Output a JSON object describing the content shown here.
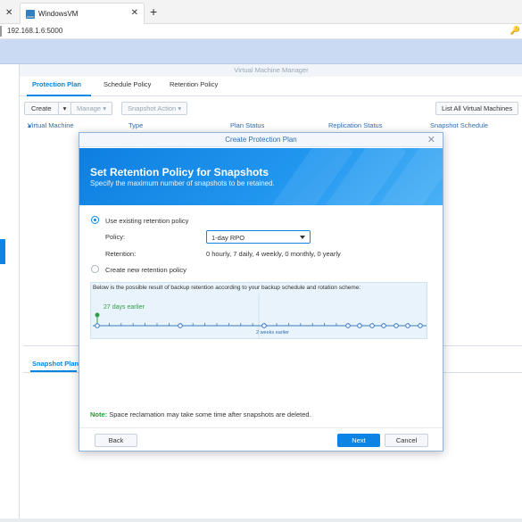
{
  "browser": {
    "tab_title": "WindowsVM",
    "url": "192.168.1.6:5000"
  },
  "app": {
    "title": "Virtual Machine Manager",
    "tabs": [
      "Protection Plan",
      "Schedule Policy",
      "Retention Policy"
    ],
    "toolbar": {
      "create": "Create",
      "manage": "Manage",
      "snapshot_action": "Snapshot Action",
      "list_all": "List All Virtual Machines"
    },
    "columns": [
      "Virtual Machine",
      "Type",
      "Plan Status",
      "Replication Status",
      "Snapshot Schedule"
    ],
    "bottom_tab": "Snapshot Plan"
  },
  "dialog": {
    "title": "Create Protection Plan",
    "hero_title": "Set Retention Policy for Snapshots",
    "hero_subtitle": "Specify the maximum number of snapshots to be retained.",
    "option_existing": "Use existing retention policy",
    "policy_label": "Policy:",
    "policy_value": "1-day RPO",
    "retention_label": "Retention:",
    "retention_value": "0 hourly, 7 daily, 4 weekly, 0 monthly, 0 yearly",
    "option_new": "Create new retention policy",
    "timeline_text": "Below is the possible result of backup retention according to your backup schedule and rotation scheme:",
    "timeline_marker": "27 days earlier",
    "timeline_mid": "2 weeks earlier",
    "note_label": "Note:",
    "note_text": " Space reclamation may take some time after snapshots are deleted.",
    "back": "Back",
    "next": "Next",
    "cancel": "Cancel",
    "selected_option": "existing"
  },
  "colors": {
    "accent": "#0b84e6",
    "note_green": "#1a9f37",
    "timeline_green": "#2f9e44"
  }
}
